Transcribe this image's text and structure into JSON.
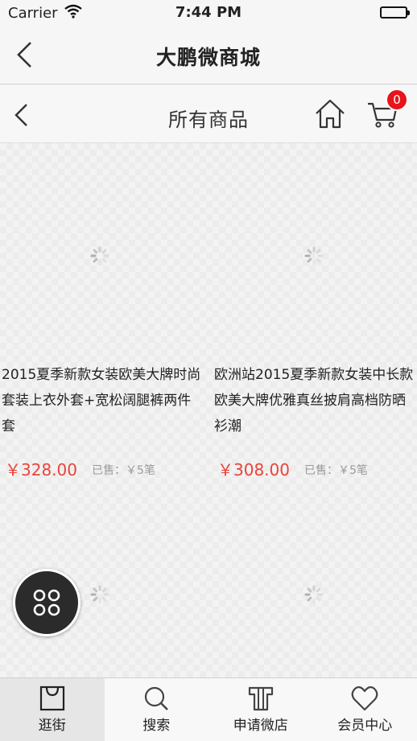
{
  "status_bar": {
    "carrier": "Carrier",
    "time": "7:44 PM"
  },
  "nav": {
    "title": "大鹏微商城"
  },
  "subheader": {
    "title": "所有商品",
    "cart_count": "0"
  },
  "products": [
    {
      "name": "2015夏季新款女装欧美大牌时尚套装上衣外套+宽松阔腿裤两件套",
      "price": "￥328.00",
      "sold": "已售：￥5笔"
    },
    {
      "name": "欧洲站2015夏季新款女装中长款欧美大牌优雅真丝披肩高档防晒衫潮",
      "price": "￥308.00",
      "sold": "已售：￥5笔"
    }
  ],
  "tabs": [
    {
      "label": "逛街",
      "icon": "bag-icon",
      "active": true
    },
    {
      "label": "搜索",
      "icon": "search-icon",
      "active": false
    },
    {
      "label": "申请微店",
      "icon": "shirt-icon",
      "active": false
    },
    {
      "label": "会员中心",
      "icon": "heart-icon",
      "active": false
    }
  ],
  "colors": {
    "price": "#e8443a",
    "badge": "#e8141b",
    "active_tab_bg": "#e6e6e6"
  }
}
